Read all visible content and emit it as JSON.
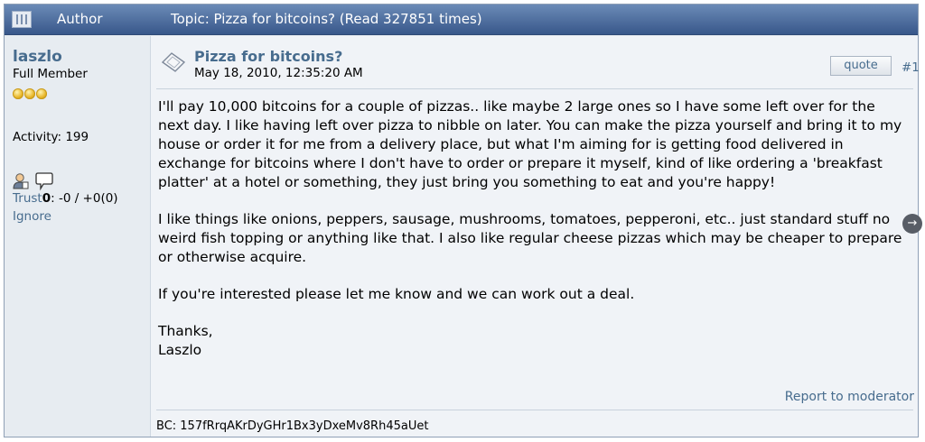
{
  "header": {
    "author_label": "Author",
    "topic_text": "Topic: Pizza for bitcoins?  (Read 327851 times)"
  },
  "poster": {
    "name": "laszlo",
    "rank": "Full Member",
    "activity": "Activity: 199",
    "trust_label": "Trust",
    "trust_score": "0",
    "trust_detail": ": -0 / +0(0)",
    "ignore_label": "Ignore",
    "icons": [
      "user-profile-icon",
      "message-bubble-icon"
    ]
  },
  "post": {
    "icon": "post-document-icon",
    "title": "Pizza for bitcoins?",
    "date": "May 18, 2010, 12:35:20 AM",
    "quote_label": "quote",
    "number": "#1",
    "paragraphs": [
      "I'll pay 10,000 bitcoins for a couple of pizzas.. like maybe 2 large ones so I have some left over for the next day.  I like having left over pizza to nibble on later.  You can make the pizza yourself and bring it to my house or order it for me from a delivery place, but what I'm aiming for is getting food delivered in exchange for bitcoins where I don't have to order or prepare it myself, kind of like ordering a 'breakfast platter' at a hotel or something, they just bring you something to eat and you're happy!",
      "I like things like onions, peppers, sausage, mushrooms, tomatoes, pepperoni, etc.. just standard stuff no weird fish topping or anything like that.  I also like regular cheese pizzas which may be cheaper to prepare or otherwise acquire.",
      "If you're interested please let me know and we can work out a deal.",
      "Thanks,",
      "Laszlo"
    ],
    "report_label": "Report to moderator",
    "signature": "BC: 157fRrqAKrDyGHr1Bx3yDxeMv8Rh45aUet"
  },
  "overlay": {
    "next_arrow": "→"
  },
  "colors": {
    "header_top": "#6b8bb7",
    "header_bottom": "#38578a",
    "link": "#476c8e",
    "background": "#e7ecf1"
  }
}
